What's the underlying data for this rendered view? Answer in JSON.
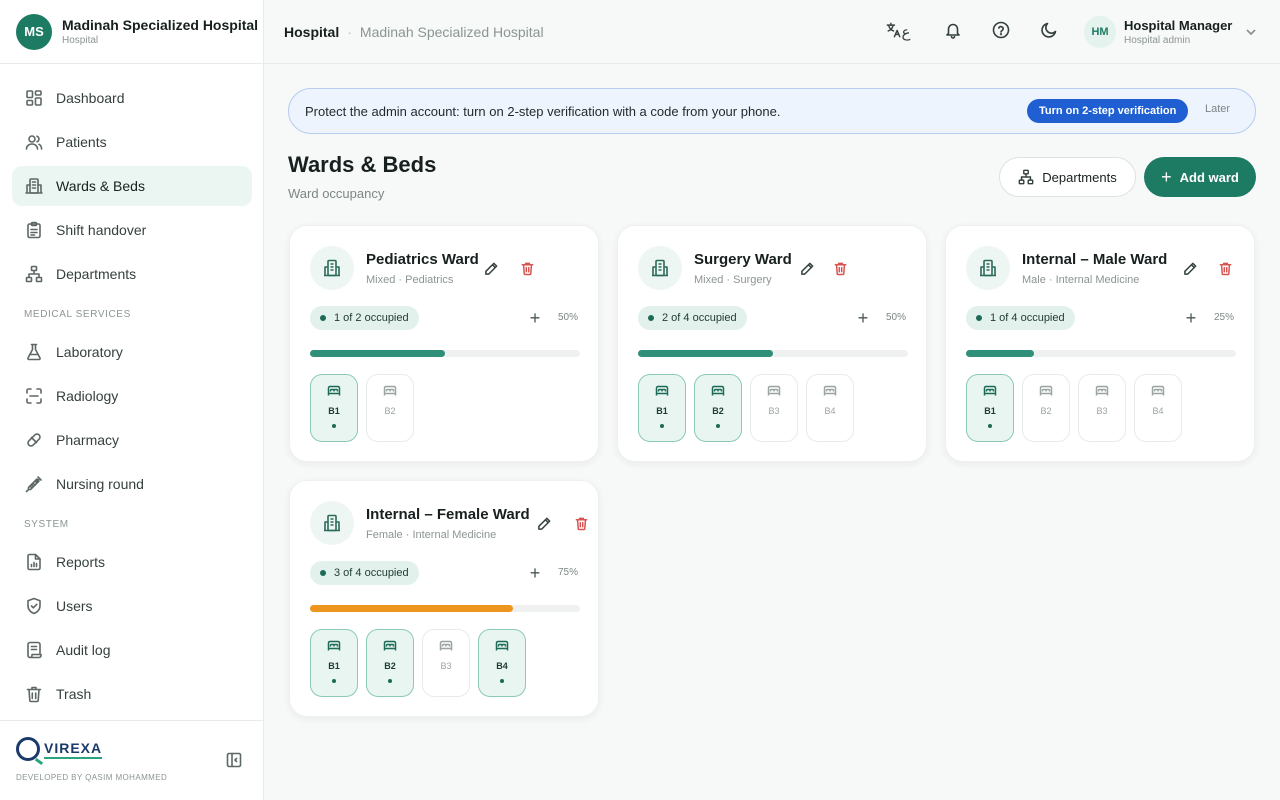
{
  "brand": {
    "initials": "MS",
    "name": "Madinah Specialized Hospital",
    "type": "Hospital"
  },
  "nav": {
    "items_main": [
      {
        "label": "Dashboard",
        "icon": "dashboard-icon"
      },
      {
        "label": "Patients",
        "icon": "users-icon"
      },
      {
        "label": "Wards & Beds",
        "icon": "building-icon",
        "active": true
      },
      {
        "label": "Shift handover",
        "icon": "clipboard-icon"
      },
      {
        "label": "Departments",
        "icon": "org-chart-icon"
      }
    ],
    "section_medical": "MEDICAL SERVICES",
    "items_medical": [
      {
        "label": "Laboratory",
        "icon": "flask-icon"
      },
      {
        "label": "Radiology",
        "icon": "scan-icon"
      },
      {
        "label": "Pharmacy",
        "icon": "pill-icon"
      },
      {
        "label": "Nursing round",
        "icon": "syringe-icon"
      }
    ],
    "section_system": "SYSTEM",
    "items_system": [
      {
        "label": "Reports",
        "icon": "report-icon"
      },
      {
        "label": "Users",
        "icon": "shield-icon"
      },
      {
        "label": "Audit log",
        "icon": "scroll-icon"
      },
      {
        "label": "Trash",
        "icon": "trash-icon"
      }
    ]
  },
  "footer": {
    "logo_text": "VIREXA",
    "credit": "DEVELOPED BY QASIM MOHAMMED"
  },
  "topbar": {
    "breadcrumb_root": "Hospital",
    "breadcrumb_sep": "·",
    "breadcrumb_current": "Madinah Specialized Hospital",
    "lang_glyph": "ع"
  },
  "user": {
    "initials": "HM",
    "name": "Hospital Manager",
    "role": "Hospital admin"
  },
  "banner": {
    "text": "Protect the admin account: turn on 2-step verification with a code from your phone.",
    "action": "Turn on 2-step verification",
    "dismiss": "Later"
  },
  "page": {
    "title": "Wards & Beds",
    "subtitle": "Ward occupancy",
    "departments_button": "Departments",
    "add_ward_button": "Add ward"
  },
  "wards": [
    {
      "name": "Pediatrics Ward",
      "meta": "Mixed · Pediatrics",
      "occupancy": "1 of 2 occupied",
      "percent_label": "50%",
      "fill": 0.5,
      "warn": false,
      "beds": [
        {
          "label": "B1",
          "occupied": true
        },
        {
          "label": "B2",
          "occupied": false
        }
      ]
    },
    {
      "name": "Surgery Ward",
      "meta": "Mixed · Surgery",
      "occupancy": "2 of 4 occupied",
      "percent_label": "50%",
      "fill": 0.5,
      "warn": false,
      "beds": [
        {
          "label": "B1",
          "occupied": true
        },
        {
          "label": "B2",
          "occupied": true
        },
        {
          "label": "B3",
          "occupied": false
        },
        {
          "label": "B4",
          "occupied": false
        }
      ]
    },
    {
      "name": "Internal – Male Ward",
      "meta": "Male · Internal Medicine",
      "occupancy": "1 of 4 occupied",
      "percent_label": "25%",
      "fill": 0.25,
      "warn": false,
      "beds": [
        {
          "label": "B1",
          "occupied": true
        },
        {
          "label": "B2",
          "occupied": false
        },
        {
          "label": "B3",
          "occupied": false
        },
        {
          "label": "B4",
          "occupied": false
        }
      ]
    },
    {
      "name": "Internal – Female Ward",
      "meta": "Female · Internal Medicine",
      "occupancy": "3 of 4 occupied",
      "percent_label": "75%",
      "fill": 0.75,
      "warn": true,
      "beds": [
        {
          "label": "B1",
          "occupied": true
        },
        {
          "label": "B2",
          "occupied": true
        },
        {
          "label": "B3",
          "occupied": false
        },
        {
          "label": "B4",
          "occupied": true
        }
      ]
    }
  ],
  "colors": {
    "primary": "#1d7a63",
    "banner_button": "#1f5fd1",
    "delete": "#d9534f",
    "warn_bar": "#ee951e"
  }
}
